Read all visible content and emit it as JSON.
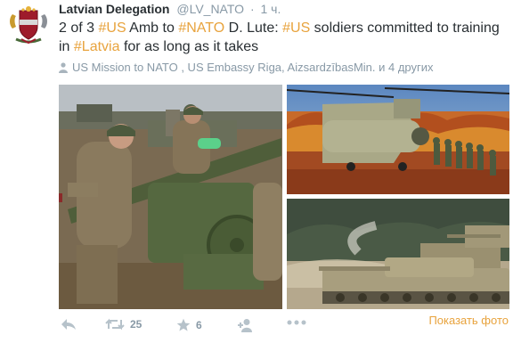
{
  "tweet": {
    "author_name": "Latvian Delegation",
    "handle": "@LV_NATO",
    "separator": "·",
    "time": "1 ч.",
    "text_segments": [
      {
        "text": "2 of 3 ",
        "tag": false
      },
      {
        "text": "#US",
        "tag": true
      },
      {
        "text": " Amb to ",
        "tag": false
      },
      {
        "text": "#NATO",
        "tag": true
      },
      {
        "text": " D. Lute: ",
        "tag": false
      },
      {
        "text": "#US",
        "tag": true
      },
      {
        "text": " soldiers committed to training in ",
        "tag": false
      },
      {
        "text": "#Latvia",
        "tag": true
      },
      {
        "text": " for as long as it takes",
        "tag": false
      }
    ],
    "mentions": "US Mission to NATO , US Embassy Riga, AizsardzībasMin. и 4 других",
    "show_photos_label": "Показать фото",
    "retweet_count": "25",
    "favorite_count": "6"
  },
  "colors": {
    "accent": "#e8a33d",
    "muted": "#8899a6",
    "text": "#292f33",
    "avatar_red": "#9e1b2b"
  },
  "icons": {
    "reply": "reply-icon",
    "retweet": "retweet-icon",
    "favorite": "star-icon",
    "follow": "add-user-icon",
    "more": "more-dots-icon",
    "mentions": "person-icon",
    "avatar": "latvian-coat-of-arms-icon"
  }
}
